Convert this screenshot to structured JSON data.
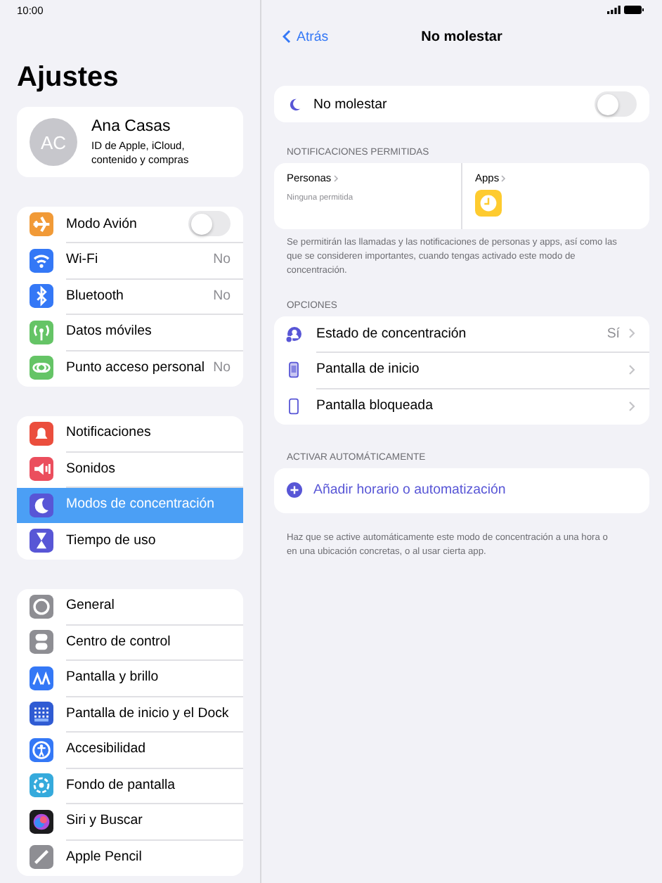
{
  "status_bar": {
    "time": "10:00"
  },
  "sidebar": {
    "title": "Ajustes",
    "profile": {
      "initials": "AC",
      "name": "Ana Casas",
      "subtitle": "ID de Apple, iCloud, contenido y compras"
    },
    "groups": [
      {
        "items": [
          {
            "label": "Modo Avión",
            "kind": "toggle",
            "on": false,
            "selected": false
          },
          {
            "label": "Wi-Fi",
            "kind": "value",
            "value": "No",
            "selected": false
          },
          {
            "label": "Bluetooth",
            "kind": "value",
            "value": "No",
            "selected": false
          },
          {
            "label": "Datos móviles",
            "kind": "plain",
            "selected": false
          },
          {
            "label": "Punto acceso personal",
            "kind": "value",
            "value": "No",
            "selected": false
          }
        ]
      },
      {
        "items": [
          {
            "label": "Notificaciones",
            "kind": "plain",
            "selected": false
          },
          {
            "label": "Sonidos",
            "kind": "plain",
            "selected": false
          },
          {
            "label": "Modos de concentración",
            "kind": "plain",
            "selected": true
          },
          {
            "label": "Tiempo de uso",
            "kind": "plain",
            "selected": false
          }
        ]
      },
      {
        "items": [
          {
            "label": "General",
            "kind": "plain",
            "selected": false
          },
          {
            "label": "Centro de control",
            "kind": "plain",
            "selected": false
          },
          {
            "label": "Pantalla y brillo",
            "kind": "plain",
            "selected": false
          },
          {
            "label": "Pantalla de inicio y el Dock",
            "kind": "plain",
            "selected": false
          },
          {
            "label": "Accesibilidad",
            "kind": "plain",
            "selected": false
          },
          {
            "label": "Fondo de pantalla",
            "kind": "plain",
            "selected": false
          },
          {
            "label": "Siri y Buscar",
            "kind": "plain",
            "selected": false
          },
          {
            "label": "Apple Pencil",
            "kind": "plain",
            "selected": false
          }
        ]
      }
    ]
  },
  "detail": {
    "back": "Atrás",
    "title": "No molestar",
    "focus_toggle": {
      "label": "No molestar",
      "on": false
    },
    "allowed": {
      "header": "NOTIFICACIONES PERMITIDAS",
      "people_label": "Personas",
      "people_value": "Ninguna permitida",
      "apps_label": "Apps",
      "footer": "Se permitirán las llamadas y las notificaciones de personas y apps, así como las que se consideren importantes, cuando tengas activado este modo de concentración."
    },
    "options": {
      "header": "OPCIONES",
      "items": [
        {
          "label": "Estado de concentración",
          "value": "Sí"
        },
        {
          "label": "Pantalla de inicio"
        },
        {
          "label": "Pantalla bloqueada"
        }
      ]
    },
    "automation": {
      "header": "ACTIVAR AUTOMÁTICAMENTE",
      "add": "Añadir horario o automatización",
      "footer": "Haz que se active automáticamente este modo de concentración a una hora o en una ubicación concretas, o al usar cierta app."
    }
  }
}
